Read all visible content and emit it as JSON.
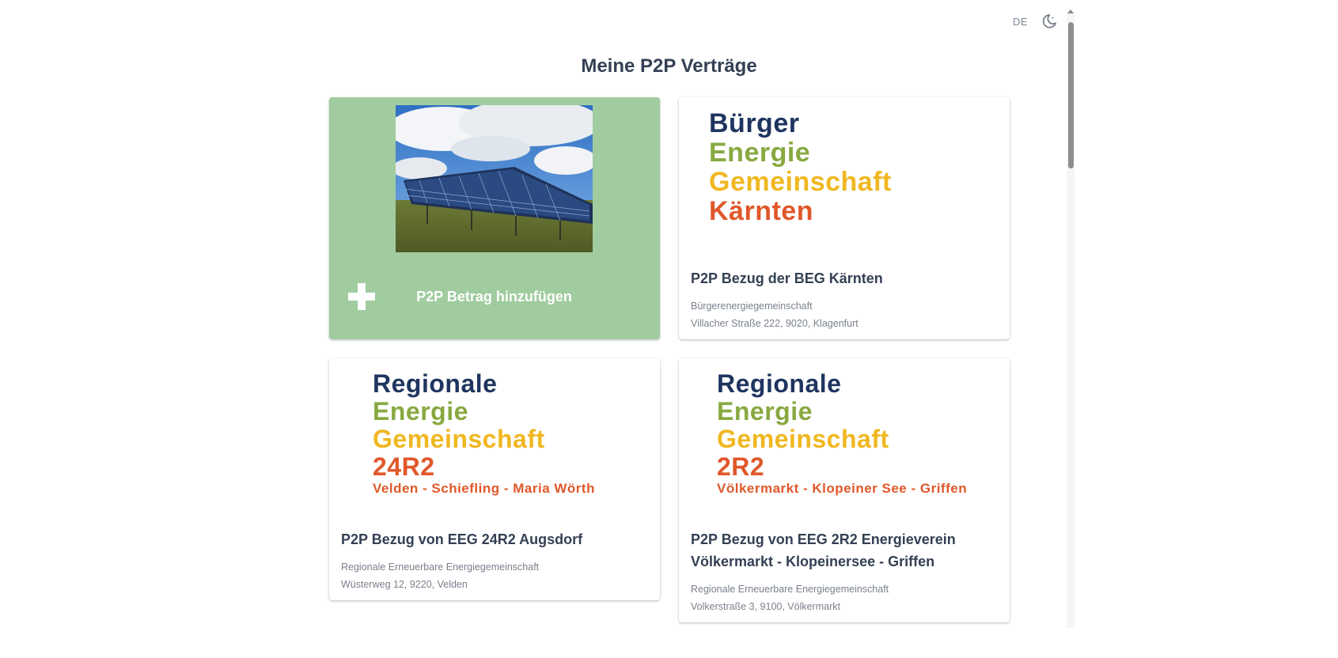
{
  "header": {
    "language": "DE",
    "theme_icon": "moon-icon"
  },
  "page": {
    "title": "Meine P2P Verträge"
  },
  "add_card": {
    "label": "P2P Betrag hinzufügen",
    "icon": "plus-icon",
    "image": "solar-panels-photo"
  },
  "cards": [
    {
      "logo_lines": [
        "Bürger",
        "Energie",
        "Gemeinschaft",
        "Kärnten"
      ],
      "title": "P2P Bezug der BEG Kärnten",
      "type": "Bürgerenergiegemeinschaft",
      "address": "Villacher Straße 222, 9020, Klagenfurt"
    },
    {
      "logo_lines": [
        "Regionale",
        "Energie",
        "Gemeinschaft",
        "24R2",
        "Velden - Schiefling - Maria Wörth"
      ],
      "title": "P2P Bezug von EEG 24R2 Augsdorf",
      "type": "Regionale Erneuerbare Energiegemeinschaft",
      "address": "Wüsterweg 12, 9220, Velden"
    },
    {
      "logo_lines": [
        "Regionale",
        "Energie",
        "Gemeinschaft",
        "2R2",
        "Völkermarkt - Klopeiner See - Griffen"
      ],
      "title": "P2P Bezug von EEG 2R2 Energieverein Völkermarkt - Klopeinersee - Griffen",
      "type": "Regionale Erneuerbare Energiegemeinschaft",
      "address": "Volkerstraße 3, 9100, Völkermarkt"
    }
  ],
  "colors": {
    "add_card_bg": "#a0cca0",
    "logo_navy": "#1f3560",
    "logo_green": "#87a940",
    "logo_yellow": "#f0b720",
    "logo_red": "#e0582a"
  }
}
